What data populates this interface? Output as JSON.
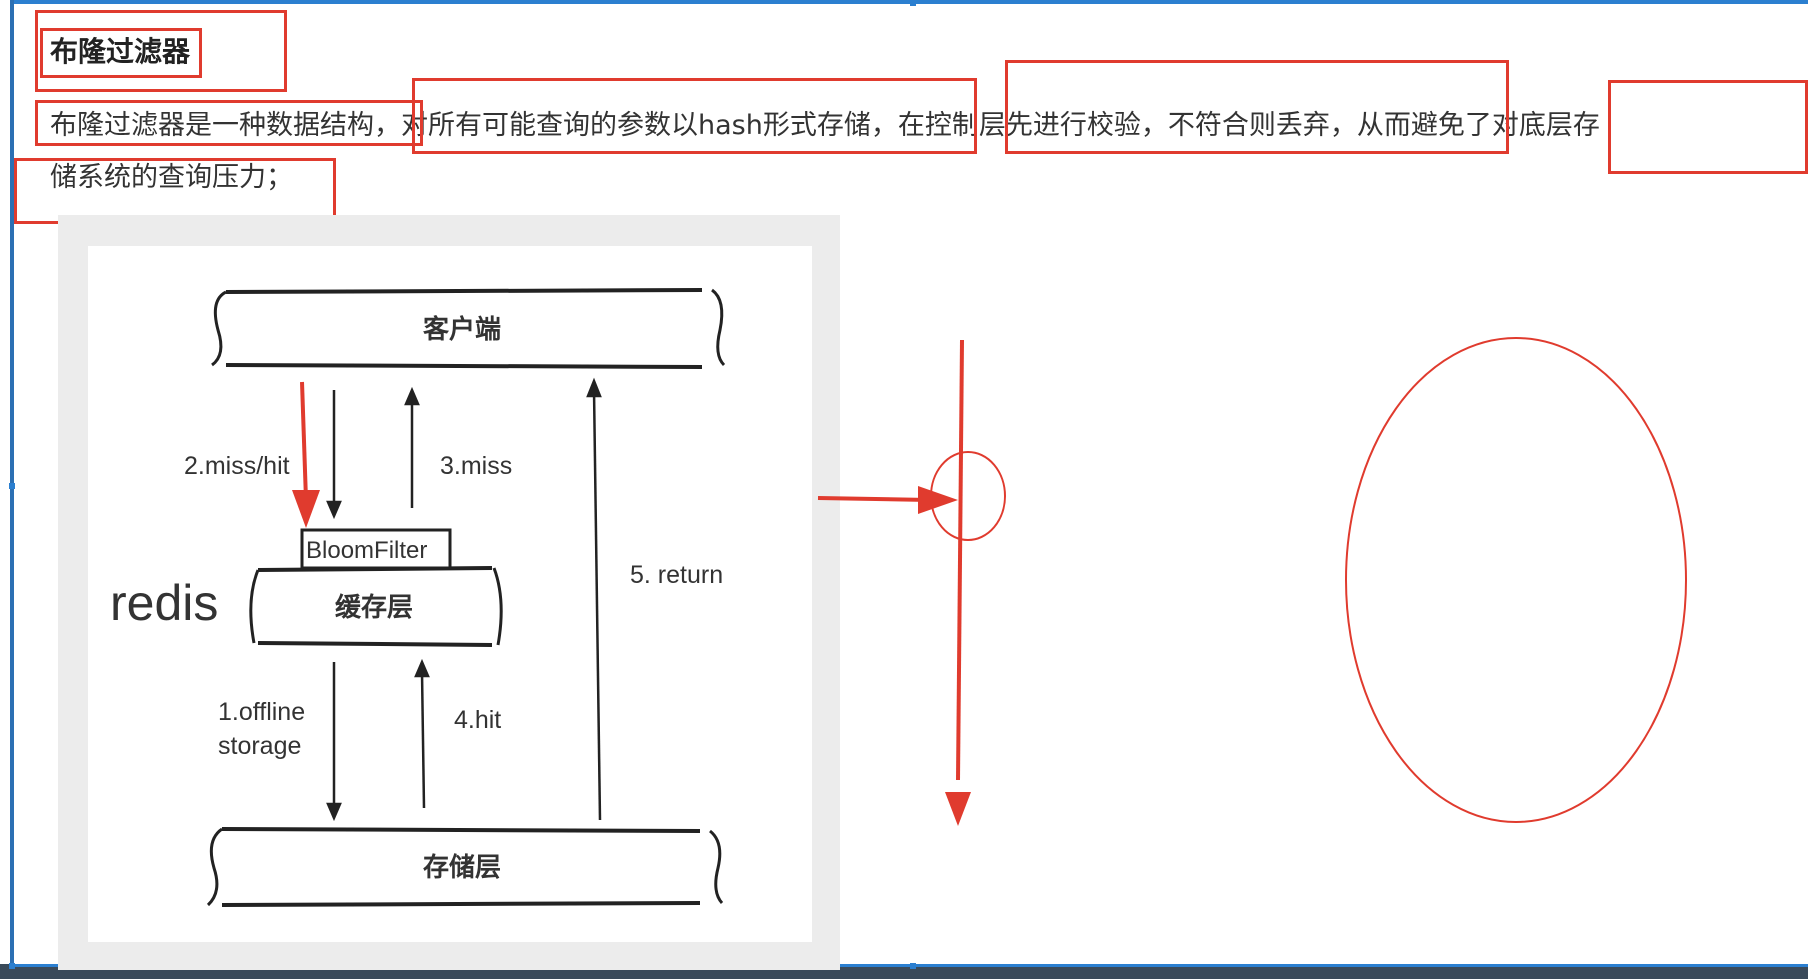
{
  "heading": "布隆过滤器",
  "paragraph": {
    "line1": "布隆过滤器是一种数据结构，对所有可能查询的参数以hash形式存储，在控制层先进行校验，不符合则丢弃，从而避免了对底层存",
    "line2": "储系统的查询压力；"
  },
  "diagram": {
    "client_label": "客户端",
    "cache_label": "缓存层",
    "storage_label": "存储层",
    "bloom_label": "BloomFilter",
    "redis_label": "redis",
    "miss_hit_label": "2.miss/hit",
    "miss_label": "3.miss",
    "return_label": "5. return",
    "offline_label_1": "1.offline",
    "offline_label_2": "storage",
    "hit_label": "4.hit"
  },
  "colors": {
    "annotation_red": "#e03b2e",
    "frame_blue": "#2b7fd0"
  }
}
